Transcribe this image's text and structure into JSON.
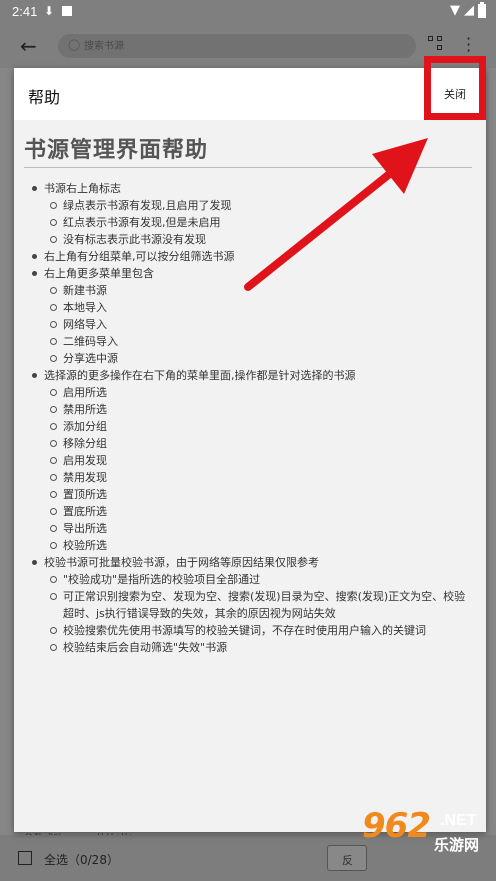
{
  "status": {
    "time": "2:41"
  },
  "appbar": {
    "search_placeholder": "搜索书源"
  },
  "background": {
    "select_all": "全选（0/28）",
    "partial_row": "1 参数成功 0.0.0 共计(共)",
    "bottom_button": "反"
  },
  "dialog": {
    "title": "帮助",
    "close_label": "关闭",
    "doc_title": "书源管理界面帮助",
    "items": [
      {
        "text": "书源右上角标志",
        "children": [
          "绿点表示书源有发现,且启用了发现",
          "红点表示书源有发现,但是未启用",
          "没有标志表示此书源没有发现"
        ]
      },
      {
        "text": "右上角有分组菜单,可以按分组筛选书源",
        "children": []
      },
      {
        "text": "右上角更多菜单里包含",
        "children": [
          "新建书源",
          "本地导入",
          "网络导入",
          "二维码导入",
          "分享选中源"
        ]
      },
      {
        "text": "选择源的更多操作在右下角的菜单里面,操作都是针对选择的书源",
        "children": [
          "启用所选",
          "禁用所选",
          "添加分组",
          "移除分组",
          "启用发现",
          "禁用发现",
          "置顶所选",
          "置底所选",
          "导出所选",
          "校验所选"
        ]
      },
      {
        "text": "校验书源可批量校验书源，由于网络等原因结果仅限参考",
        "children": [
          "\"校验成功\"是指所选的校验项目全部通过",
          "可正常识别搜索为空、发现为空、搜索(发现)目录为空、搜索(发现)正文为空、校验超时、js执行错误导致的失效，其余的原因视为网站失效",
          "校验搜索优先使用书源填写的校验关键词，不存在时使用用户输入的关键词",
          "校验结束后会自动筛选\"失效\"书源"
        ]
      }
    ]
  },
  "watermark": {
    "number": "962",
    "net": ".NET",
    "cn": "乐游网"
  },
  "colors": {
    "highlight": "#e0131a",
    "watermark_orange": "#f08a1c"
  }
}
